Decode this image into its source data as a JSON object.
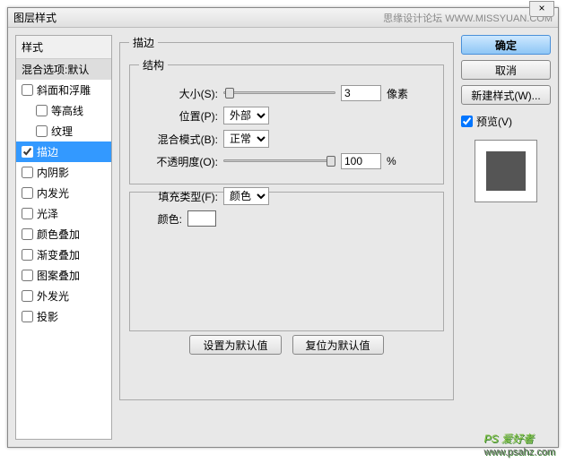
{
  "title": "图层样式",
  "title_right": "思缘设计论坛   WWW.MISSYUAN.COM",
  "close_glyph": "×",
  "styles": {
    "header": "样式",
    "blending": "混合选项:默认",
    "items": [
      {
        "label": "斜面和浮雕",
        "checked": false,
        "indent": false
      },
      {
        "label": "等高线",
        "checked": false,
        "indent": true
      },
      {
        "label": "纹理",
        "checked": false,
        "indent": true
      },
      {
        "label": "描边",
        "checked": true,
        "indent": false,
        "selected": true
      },
      {
        "label": "内阴影",
        "checked": false,
        "indent": false
      },
      {
        "label": "内发光",
        "checked": false,
        "indent": false
      },
      {
        "label": "光泽",
        "checked": false,
        "indent": false
      },
      {
        "label": "颜色叠加",
        "checked": false,
        "indent": false
      },
      {
        "label": "渐变叠加",
        "checked": false,
        "indent": false
      },
      {
        "label": "图案叠加",
        "checked": false,
        "indent": false
      },
      {
        "label": "外发光",
        "checked": false,
        "indent": false
      },
      {
        "label": "投影",
        "checked": false,
        "indent": false
      }
    ]
  },
  "main": {
    "section_title": "描边",
    "structure_title": "结构",
    "size_label": "大小(S):",
    "size_value": "3",
    "size_unit": "像素",
    "position_label": "位置(P):",
    "position_value": "外部",
    "blend_label": "混合模式(B):",
    "blend_value": "正常",
    "opacity_label": "不透明度(O):",
    "opacity_value": "100",
    "opacity_unit": "%",
    "filltype_label": "填充类型(F):",
    "filltype_value": "颜色",
    "color_label": "颜色:",
    "color_value": "#ffffff",
    "btn_default": "设置为默认值",
    "btn_reset": "复位为默认值"
  },
  "right": {
    "ok": "确定",
    "cancel": "取消",
    "newstyle": "新建样式(W)...",
    "preview_label": "预览(V)",
    "preview_checked": true
  },
  "watermark": {
    "big": "PS 爱好者",
    "small": "www.psahz.com"
  }
}
